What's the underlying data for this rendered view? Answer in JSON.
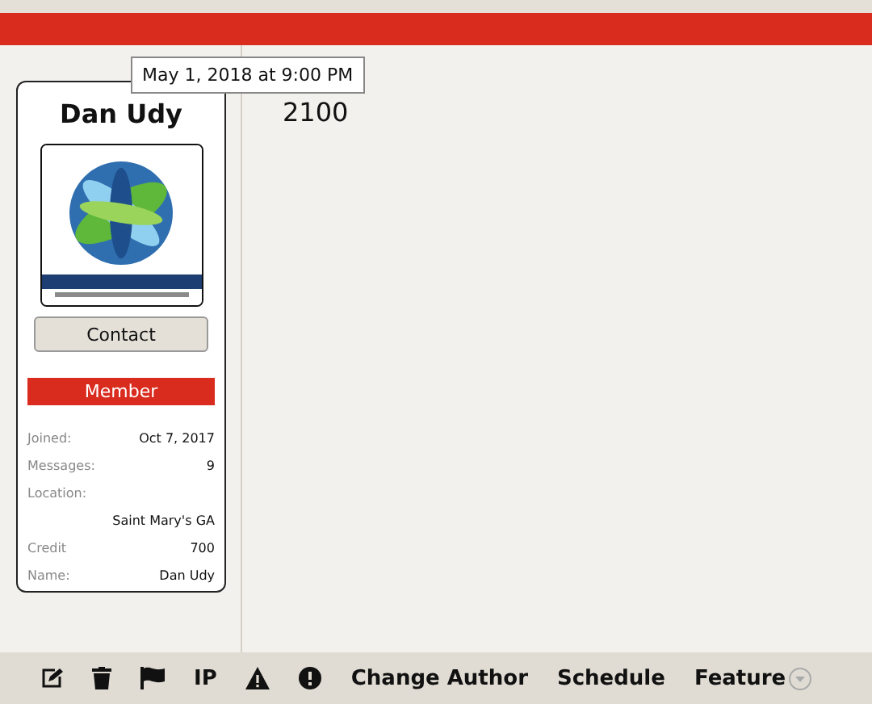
{
  "profile": {
    "name": "Dan Udy",
    "contact_button": "Contact",
    "role": "Member",
    "stats": [
      {
        "label": "Joined:",
        "value": "Oct 7, 2017",
        "kind": "inline"
      },
      {
        "label": "Messages:",
        "value": "9",
        "kind": "inline"
      },
      {
        "label": "Location:",
        "value": "Saint Mary's GA",
        "kind": "stacked"
      },
      {
        "label": "Credit",
        "value": "700",
        "kind": "inline"
      },
      {
        "label": "Name:",
        "value": "Dan Udy",
        "kind": "inline"
      }
    ]
  },
  "post": {
    "text": "2100"
  },
  "tooltip": "May 1, 2018 at 9:00 PM",
  "toolbar": [
    {
      "kind": "edit"
    },
    {
      "kind": "delete"
    },
    {
      "kind": "flag"
    },
    {
      "kind": "text",
      "label": "IP"
    },
    {
      "kind": "warning"
    },
    {
      "kind": "alert"
    },
    {
      "kind": "text",
      "label": "Change Author"
    },
    {
      "kind": "text",
      "label": "Schedule"
    },
    {
      "kind": "dropdown",
      "label": "Feature"
    }
  ]
}
